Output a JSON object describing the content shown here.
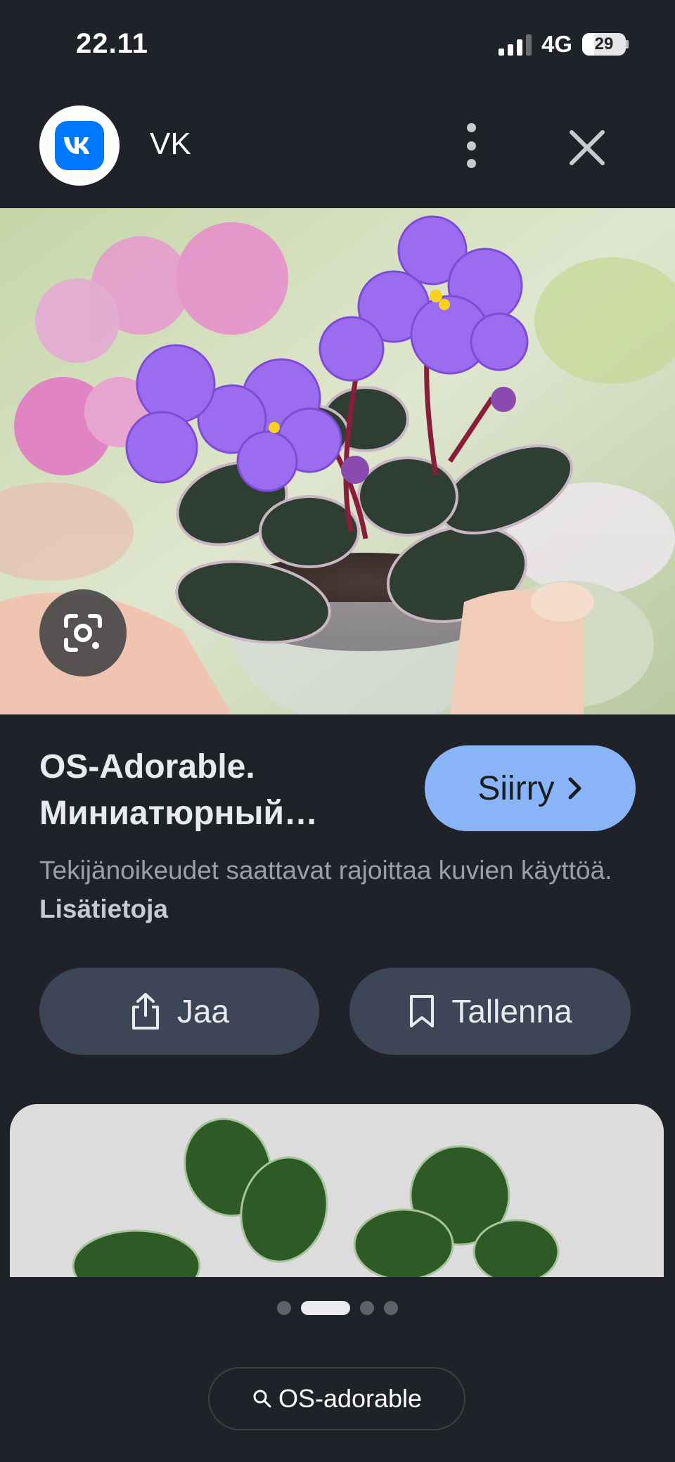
{
  "status_bar": {
    "time": "22.11",
    "network": "4G",
    "battery": "29"
  },
  "header": {
    "site_name": "VK",
    "logo_icon": "vk-logo-icon",
    "menu_icon": "more-vertical-icon",
    "close_icon": "close-icon"
  },
  "result": {
    "title_line1": "OS-Adorable.",
    "title_line2": "Миниатюрный…",
    "visit_label": "Siirry",
    "copyright_text": "Tekijänoikeudet saattavat rajoittaa kuvien käyttöä.",
    "learn_more": "Lisätietoja"
  },
  "actions": {
    "share_label": "Jaa",
    "save_label": "Tallenna"
  },
  "pagination": {
    "total": 4,
    "active_index": 1
  },
  "search_chip": {
    "label": "OS-adorable",
    "icon": "search-icon"
  },
  "colors": {
    "background": "#1f2229",
    "accent": "#8ab4f8",
    "button_bg": "#3c4657",
    "vk_blue": "#0077ff"
  }
}
